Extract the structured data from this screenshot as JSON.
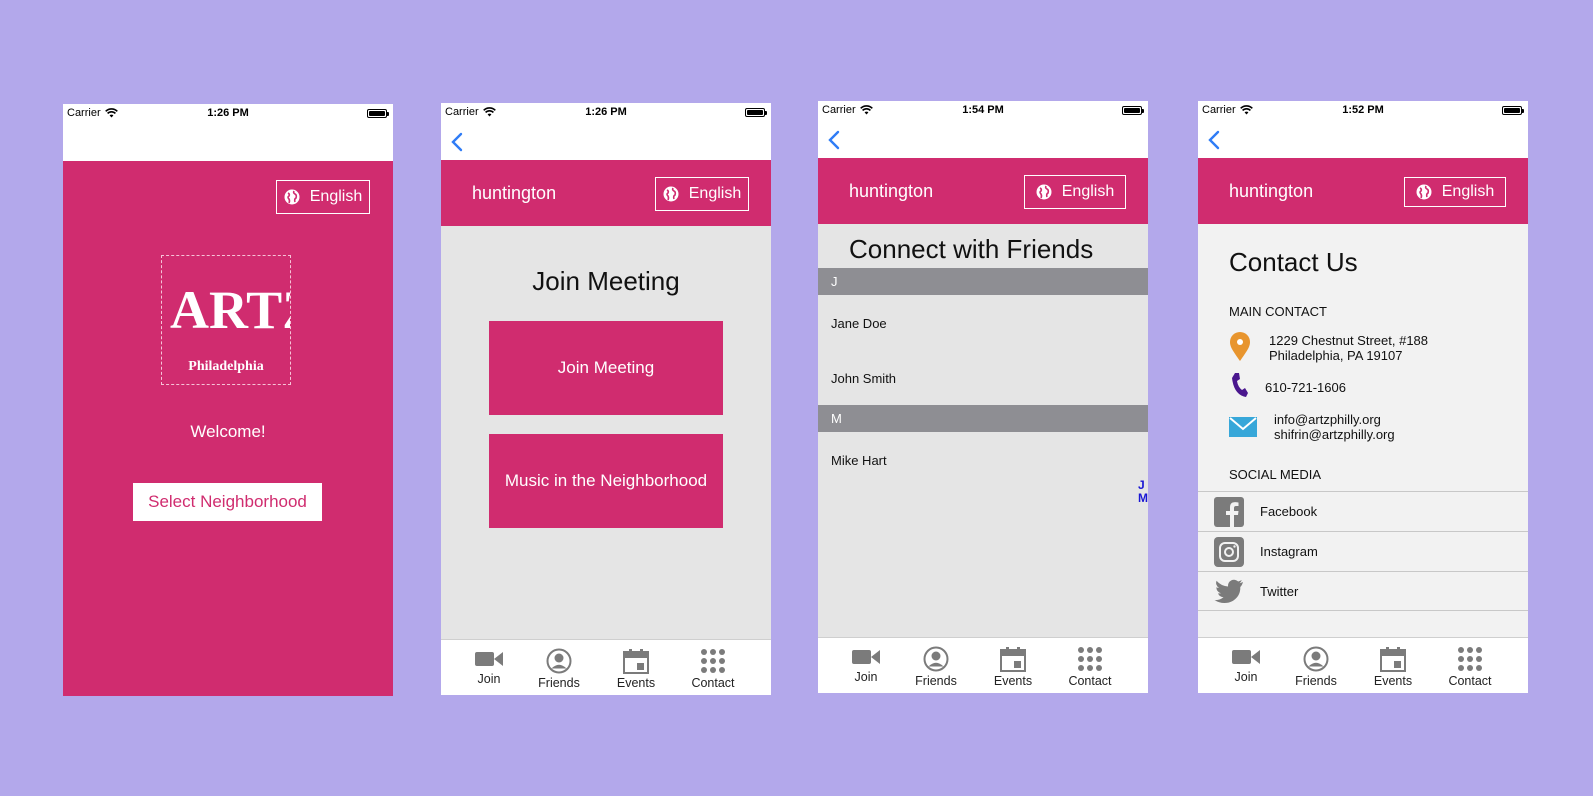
{
  "colors": {
    "background": "#b3a8eb",
    "brand_pink": "#d02c6f",
    "section_gray": "#8e8e93",
    "tab_icon_gray": "#7b7b7b",
    "link_blue": "#2f7cf6"
  },
  "status": {
    "carrier": "Carrier",
    "times": [
      "1:26 PM",
      "1:26 PM",
      "1:54 PM",
      "1:52 PM"
    ]
  },
  "common": {
    "language": "English",
    "neighborhood": "huntington"
  },
  "tabs": [
    {
      "label": "Join",
      "icon": "video-camera-icon"
    },
    {
      "label": "Friends",
      "icon": "person-icon"
    },
    {
      "label": "Events",
      "icon": "calendar-icon"
    },
    {
      "label": "Contact",
      "icon": "grid-icon"
    }
  ],
  "welcome_screen": {
    "logo": {
      "letters": "ARTZ",
      "city": "Philadelphia"
    },
    "welcome": "Welcome!",
    "select_button": "Select Neighborhood"
  },
  "join_screen": {
    "title": "Join Meeting",
    "buttons": [
      "Join Meeting",
      "Music in the Neighborhood"
    ]
  },
  "friends_screen": {
    "title": "Connect with Friends",
    "sections": [
      {
        "header": "J",
        "items": [
          "Jane Doe",
          "John Smith"
        ]
      },
      {
        "header": "M",
        "items": [
          "Mike Hart"
        ]
      }
    ],
    "index": [
      "J",
      "M"
    ]
  },
  "contact_screen": {
    "title": "Contact Us",
    "main_contact_label": "MAIN CONTACT",
    "address": [
      "1229 Chestnut Street, #188",
      "Philadelphia, PA 19107"
    ],
    "phone": "610-721-1606",
    "emails": [
      "info@artzphilly.org",
      "shifrin@artzphilly.org"
    ],
    "social_label": "SOCIAL MEDIA",
    "social": [
      "Facebook",
      "Instagram",
      "Twitter"
    ]
  }
}
